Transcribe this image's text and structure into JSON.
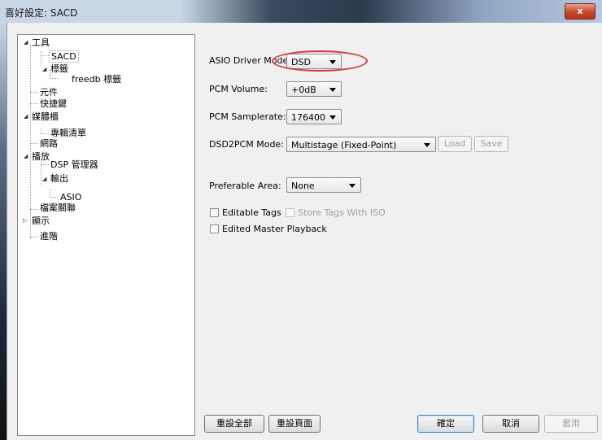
{
  "window": {
    "title": "喜好設定: SACD",
    "close_label": "x",
    "accent": "#d43b3b"
  },
  "tree": {
    "items": [
      {
        "label": "工具"
      },
      {
        "label": "SACD"
      },
      {
        "label": "標籤"
      },
      {
        "label": "freedb 標籤"
      },
      {
        "label": "元件"
      },
      {
        "label": "快捷鍵"
      },
      {
        "label": "媒體櫃"
      },
      {
        "label": "專輯清單"
      },
      {
        "label": "網路"
      },
      {
        "label": "播放"
      },
      {
        "label": "DSP 管理器"
      },
      {
        "label": "輸出"
      },
      {
        "label": "ASIO"
      },
      {
        "label": "檔案關聯"
      },
      {
        "label": "顯示"
      },
      {
        "label": "進階"
      }
    ]
  },
  "settings": {
    "asio_driver_mode": {
      "label": "ASIO Driver Mode:",
      "value": "DSD"
    },
    "pcm_volume": {
      "label": "PCM Volume:",
      "value": "+0dB"
    },
    "pcm_samplerate": {
      "label": "PCM Samplerate:",
      "value": "176400"
    },
    "dsd2pcm_mode": {
      "label": "DSD2PCM Mode:",
      "value": "Multistage (Fixed-Point)",
      "load_label": "Load",
      "save_label": "Save"
    },
    "preferable_area": {
      "label": "Preferable Area:",
      "value": "None"
    },
    "editable_tags": {
      "label": "Editable Tags",
      "checked": false
    },
    "store_tags_iso": {
      "label": "Store Tags With ISO",
      "checked": false
    },
    "edited_master": {
      "label": "Edited Master Playback",
      "checked": false
    }
  },
  "footer": {
    "reset_all": "重設全部",
    "reset_page": "重設頁面",
    "ok": "確定",
    "cancel": "取消",
    "apply": "套用"
  }
}
